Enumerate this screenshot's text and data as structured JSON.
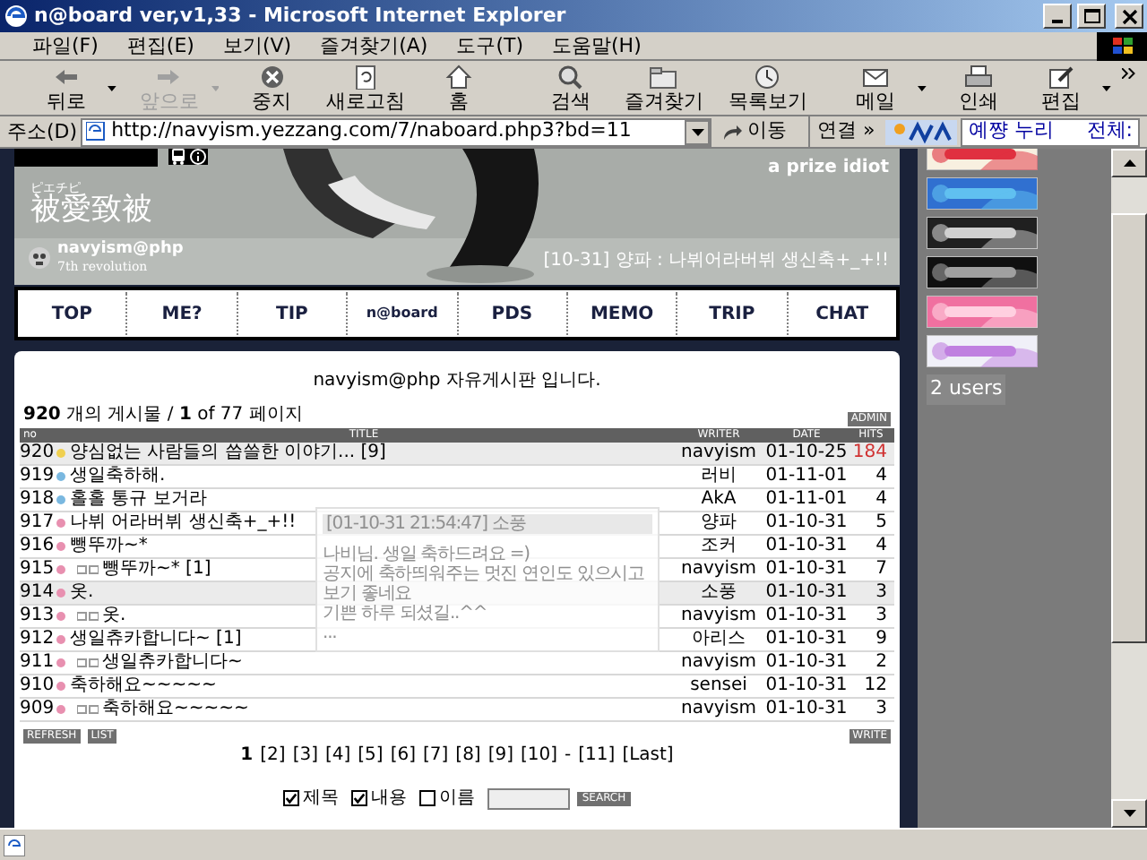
{
  "window": {
    "title": "n@board ver,v1,33 - Microsoft Internet Explorer"
  },
  "menu": [
    "파일(F)",
    "편집(E)",
    "보기(V)",
    "즐겨찾기(A)",
    "도구(T)",
    "도움말(H)"
  ],
  "toolbar": [
    {
      "label": "뒤로",
      "dropdown": true,
      "disabled": false
    },
    {
      "label": "앞으로",
      "dropdown": true,
      "disabled": true
    },
    {
      "label": "중지",
      "dropdown": false,
      "disabled": false
    },
    {
      "label": "새로고침",
      "dropdown": false,
      "disabled": false
    },
    {
      "label": "홈",
      "dropdown": false,
      "disabled": false
    },
    {
      "label": "검색",
      "dropdown": false,
      "disabled": false
    },
    {
      "label": "즐겨찾기",
      "dropdown": false,
      "disabled": false
    },
    {
      "label": "목록보기",
      "dropdown": false,
      "disabled": false
    },
    {
      "label": "메일",
      "dropdown": true,
      "disabled": false
    },
    {
      "label": "인쇄",
      "dropdown": false,
      "disabled": false
    },
    {
      "label": "편집",
      "dropdown": true,
      "disabled": false
    }
  ],
  "address": {
    "label": "주소(D)",
    "url": "http://navyism.yezzang.com/7/naboard.php3?bd=11",
    "go": "이동",
    "links": "연결 »",
    "search_value": "예쨩 누리",
    "search_label": "전체:"
  },
  "header": {
    "kana": "ピエチピ",
    "kanji": "被愛致被",
    "name": "navyism@php",
    "subtitle": "7th revolution",
    "tagline": "a prize idiot",
    "notice": "[10-31] 양파 : 나뷔어라버뷔 생신축+_+!!"
  },
  "nav": [
    "TOP",
    "ME?",
    "TIP",
    "n@board",
    "PDS",
    "MEMO",
    "TRIP",
    "CHAT"
  ],
  "board": {
    "heading": "navyism@php 자유게시판 입니다.",
    "summary": "**920** 개의 게시물 / **1** of 77 페이지",
    "admin": "ADMIN",
    "columns": [
      "no",
      "TITLE",
      "WRITER",
      "DATE",
      "HITS"
    ],
    "rows": [
      {
        "no": "920",
        "color": "#f0d050",
        "reply": false,
        "title": "양심없는 사람들의 씁쓸한 이야기... [9]",
        "writer": "navyism",
        "date": "01-10-25",
        "hits": "184",
        "hot": true,
        "highlighted": true
      },
      {
        "no": "919",
        "color": "#7ab8e0",
        "reply": false,
        "title": "생일축하해.",
        "writer": "러비",
        "date": "01-11-01",
        "hits": "4",
        "hot": false,
        "highlighted": false
      },
      {
        "no": "918",
        "color": "#7ab8e0",
        "reply": false,
        "title": "홀홀 통규 보거라",
        "writer": "AkA",
        "date": "01-11-01",
        "hits": "4",
        "hot": false,
        "highlighted": false
      },
      {
        "no": "917",
        "color": "#e890b0",
        "reply": false,
        "title": "나뷔 어라버뷔 생신축+_+!!",
        "writer": "양파",
        "date": "01-10-31",
        "hits": "5",
        "hot": false,
        "highlighted": false
      },
      {
        "no": "916",
        "color": "#e890b0",
        "reply": false,
        "title": "뺑뚜까~*",
        "writer": "조커",
        "date": "01-10-31",
        "hits": "4",
        "hot": false,
        "highlighted": false
      },
      {
        "no": "915",
        "color": "#e890b0",
        "reply": true,
        "title": "뺑뚜까~* [1]",
        "writer": "navyism",
        "date": "01-10-31",
        "hits": "7",
        "hot": false,
        "highlighted": false
      },
      {
        "no": "914",
        "color": "#e890b0",
        "reply": false,
        "title": "옷.",
        "writer": "소풍",
        "date": "01-10-31",
        "hits": "3",
        "hot": false,
        "highlighted": true
      },
      {
        "no": "913",
        "color": "#e890b0",
        "reply": true,
        "title": "옷.",
        "writer": "navyism",
        "date": "01-10-31",
        "hits": "3",
        "hot": false,
        "highlighted": false
      },
      {
        "no": "912",
        "color": "#e890b0",
        "reply": false,
        "title": "생일츄카합니다~ [1]",
        "writer": "아리스",
        "date": "01-10-31",
        "hits": "9",
        "hot": false,
        "highlighted": false
      },
      {
        "no": "911",
        "color": "#e890b0",
        "reply": true,
        "title": "생일츄카합니다~",
        "writer": "navyism",
        "date": "01-10-31",
        "hits": "2",
        "hot": false,
        "highlighted": false
      },
      {
        "no": "910",
        "color": "#e890b0",
        "reply": false,
        "title": "축하해요~~~~~",
        "writer": "sensei",
        "date": "01-10-31",
        "hits": "12",
        "hot": false,
        "highlighted": false
      },
      {
        "no": "909",
        "color": "#e890b0",
        "reply": true,
        "title": "축하해요~~~~~",
        "writer": "navyism",
        "date": "01-10-31",
        "hits": "3",
        "hot": false,
        "highlighted": false
      }
    ],
    "tooltip": {
      "header": "[01-10-31 21:54:47] 소풍",
      "lines": [
        "나비님. 생일 축하드려요 =)",
        "공지에 축하띄워주는 멋진 연인도 있으시고",
        "보기 좋네요",
        "기쁜 하루 되셨길..^^",
        "..."
      ]
    },
    "refresh": "REFRESH",
    "list": "LIST",
    "write": "WRITE",
    "pages": [
      {
        "kind": "page",
        "label": "1",
        "selected": true
      },
      {
        "kind": "page",
        "label": "[2]",
        "selected": false
      },
      {
        "kind": "page",
        "label": "[3]",
        "selected": false
      },
      {
        "kind": "page",
        "label": "[4]",
        "selected": false
      },
      {
        "kind": "page",
        "label": "[5]",
        "selected": false
      },
      {
        "kind": "page",
        "label": "[6]",
        "selected": false
      },
      {
        "kind": "page",
        "label": "[7]",
        "selected": false
      },
      {
        "kind": "page",
        "label": "[8]",
        "selected": false
      },
      {
        "kind": "page",
        "label": "[9]",
        "selected": false
      },
      {
        "kind": "page",
        "label": "[10]",
        "selected": false
      },
      {
        "kind": "separator",
        "label": "-"
      },
      {
        "kind": "page",
        "label": "[11]",
        "selected": false
      },
      {
        "kind": "page",
        "label": "[Last]",
        "selected": false
      }
    ],
    "search_options": [
      {
        "label": "제목",
        "checked": true
      },
      {
        "label": "내용",
        "checked": true
      },
      {
        "label": "이름",
        "checked": false
      }
    ],
    "search_button": "SEARCH"
  },
  "sidebar": {
    "users": "2 users"
  }
}
